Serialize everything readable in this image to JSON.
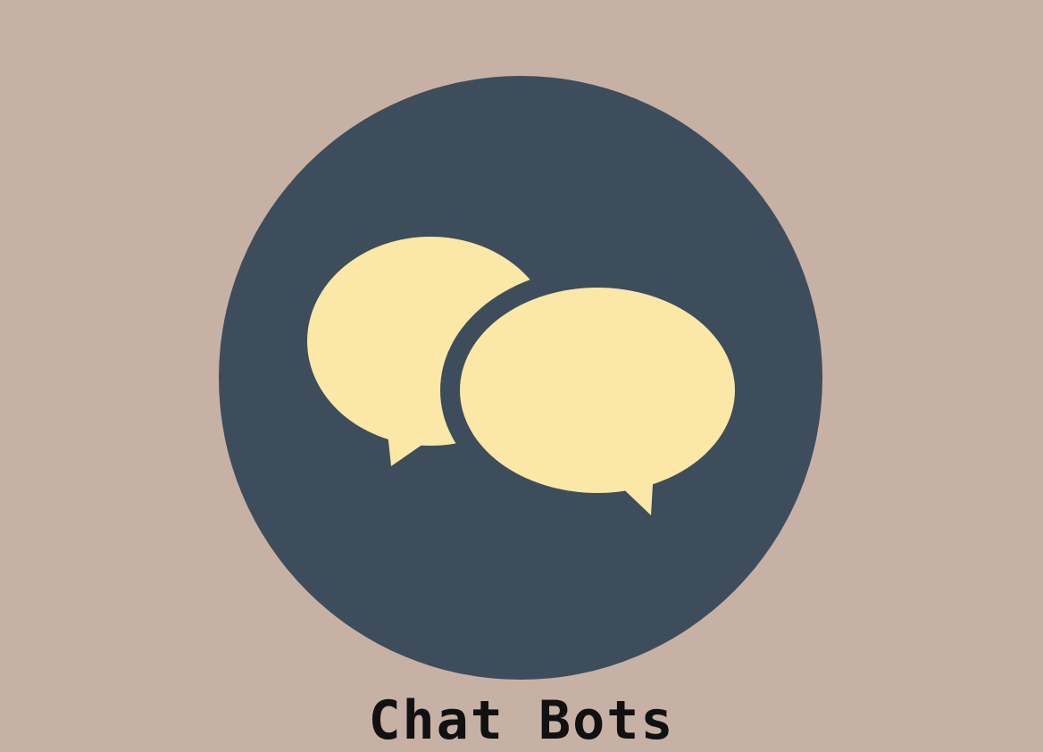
{
  "app": {
    "label": "Chat Bots",
    "icon": "chat-bubbles-icon"
  },
  "colors": {
    "background": "#c7b1a5",
    "circle": "#3d4d5b",
    "bubble": "#fbe7a6",
    "text": "#111111"
  }
}
